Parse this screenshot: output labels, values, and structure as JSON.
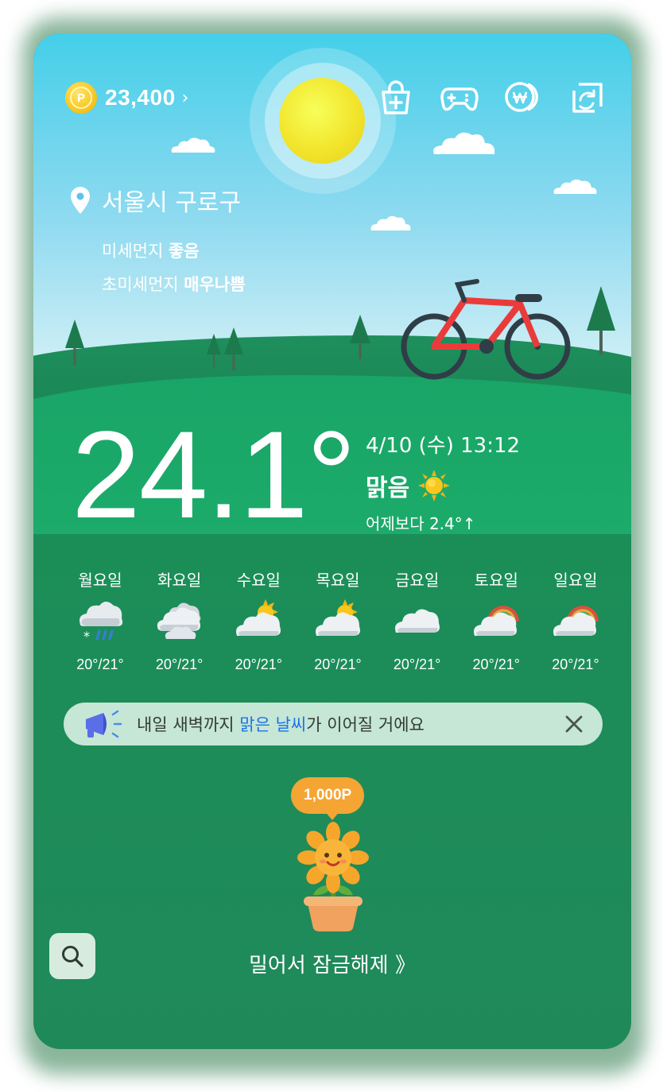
{
  "header": {
    "points_icon": "coin-p-icon",
    "coin_letter": "P",
    "points": "23,400",
    "points_chevron": "›",
    "icons": [
      "shopping-bag-plus-icon",
      "gamepad-icon",
      "won-coins-icon",
      "refresh-screen-icon"
    ]
  },
  "location": {
    "icon": "location-pin-icon",
    "name": "서울시 구로구"
  },
  "air_quality": {
    "fine_dust_label": "미세먼지",
    "fine_dust_value": "좋음",
    "ultrafine_dust_label": "초미세먼지",
    "ultrafine_dust_value": "매우나쁨"
  },
  "current": {
    "temperature": "24.1°",
    "datetime": "4/10 (수) 13:12",
    "condition": "맑음",
    "condition_icon": "sun-icon",
    "compare": "어제보다 2.4°↑"
  },
  "forecast": [
    {
      "day": "월요일",
      "icon": "cloud-rain-snow-icon",
      "temp": "20°/21°"
    },
    {
      "day": "화요일",
      "icon": "cloudy-icon",
      "temp": "20°/21°"
    },
    {
      "day": "수요일",
      "icon": "partly-sunny-icon",
      "temp": "20°/21°"
    },
    {
      "day": "목요일",
      "icon": "partly-sunny-icon",
      "temp": "20°/21°"
    },
    {
      "day": "금요일",
      "icon": "cloud-icon",
      "temp": "20°/21°"
    },
    {
      "day": "토요일",
      "icon": "rainbow-cloud-icon",
      "temp": "20°/21°"
    },
    {
      "day": "일요일",
      "icon": "rainbow-cloud-icon",
      "temp": "20°/21°"
    }
  ],
  "notice": {
    "icon": "megaphone-icon",
    "text_before": "내일 새벽까지 ",
    "text_highlight": "맑은 날씨",
    "text_after": "가 이어질 거에요",
    "close_icon": "close-icon"
  },
  "reward": {
    "badge": "1,000P",
    "image": "sunflower-pot-icon",
    "unlock_text": "밀어서 잠금해제 》"
  },
  "search": {
    "icon": "search-icon"
  },
  "colors": {
    "background_green": "#1a9d62",
    "accent_orange": "#f5a533",
    "highlight_blue": "#1a73e8",
    "coin_gold": "#f5c21b"
  }
}
